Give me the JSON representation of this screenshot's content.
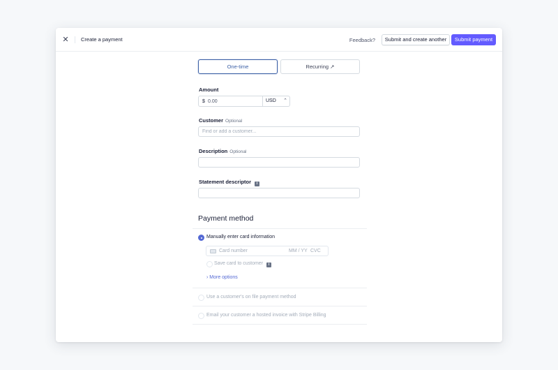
{
  "header": {
    "close_glyph": "✕",
    "title": "Create a payment",
    "feedback": "Feedback?",
    "submit_another": "Submit and create another",
    "submit": "Submit payment"
  },
  "tabs": [
    {
      "label": "One-time",
      "selected": true
    },
    {
      "label": "Recurring ↗",
      "selected": false
    }
  ],
  "amount": {
    "label": "Amount",
    "symbol": "$",
    "placeholder": "0.00",
    "currency": "USD",
    "chevron_glyph": "⌃"
  },
  "customer": {
    "label": "Customer",
    "optional": "Optional",
    "placeholder": "Find or add a customer..."
  },
  "description": {
    "label": "Description",
    "optional": "Optional"
  },
  "statement": {
    "label": "Statement descriptor",
    "info_glyph": "i"
  },
  "payment_method": {
    "title": "Payment method",
    "options": [
      {
        "label": "Manually enter card information",
        "selected": true
      },
      {
        "label": "Use a customer's on file payment method",
        "selected": false
      },
      {
        "label": "Email your customer a hosted invoice with Stripe Billing",
        "selected": false
      }
    ],
    "card": {
      "number_placeholder": "Card number",
      "expiry_placeholder": "MM / YY",
      "cvc_placeholder": "CVC"
    },
    "save_card": "Save card to customer",
    "more_options": "› More options"
  },
  "colors": {
    "primary": "#635bff",
    "selected_tab": "#3d61a6",
    "radio_selected": "#5469d4",
    "link": "#5469d4"
  }
}
